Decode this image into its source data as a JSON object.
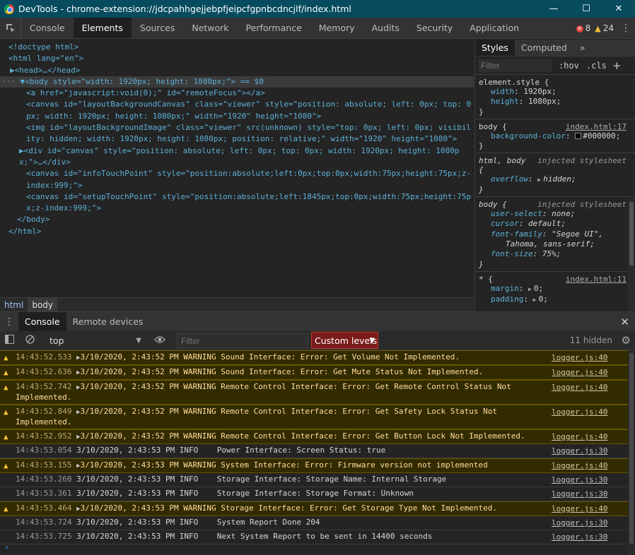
{
  "window": {
    "title": "DevTools - chrome-extension://jdcpahhgejjebpfjeipcfgpnbcdncjlf/index.html",
    "minimize": "—",
    "maximize": "☐",
    "close": "✕"
  },
  "toolbar": {
    "tabs": [
      "Console",
      "Elements",
      "Sources",
      "Network",
      "Performance",
      "Memory",
      "Audits",
      "Security",
      "Application"
    ],
    "active_tab": "Elements",
    "error_count": "8",
    "warning_count": "24"
  },
  "elements": {
    "lines": [
      {
        "text": "<!doctype html>"
      },
      {
        "text": "<html lang=\"en\">"
      },
      {
        "text": "▶<head>…</head>"
      },
      {
        "text": "▼<body style=\"width: 1920px; height: 1080px;\"> == $0"
      },
      {
        "text": "<a href=\"javascript:void(0);\" id=\"remoteFocus\"></a>"
      },
      {
        "text": "<canvas id=\"layoutBackgroundCanvas\" class=\"viewer\" style=\"position: absolute; left: 0px; top: 0px; width: 1920px; height: 1080px;\" width=\"1920\" height=\"1080\">"
      },
      {
        "text": "<img id=\"layoutBackgroundImage\" class=\"viewer\" src(unknown) style=\"top: 0px; left: 0px; visibility: hidden; width: 1920px; height: 1080px; position: relative;\" width=\"1920\" height=\"1080\">"
      },
      {
        "text": "▶<div id=\"canvas\" style=\"position: absolute; left: 0px; top: 0px; width: 1920px; height: 1080px;\">…</div>"
      },
      {
        "text": "<canvas id=\"infoTouchPoint\" style=\"position:absolute;left:0px;top:0px;width:75px;height:75px;z-index:999;\">"
      },
      {
        "text": "<canvas id=\"setupTouchPoint\" style=\"position:absolute;left:1845px;top:0px;width:75px;height:75px;z-index:999;\">"
      },
      {
        "text": "</body>"
      },
      {
        "text": "</html>"
      }
    ],
    "breadcrumbs": [
      "html",
      "body"
    ]
  },
  "styles": {
    "tabs": [
      "Styles",
      "Computed"
    ],
    "more": "»",
    "filter_placeholder": "Filter",
    "hov": ":hov",
    "cls": ".cls",
    "add": "+",
    "rules": {
      "element_style": {
        "selector": "element.style {",
        "width_name": "width",
        "width_val": "1920px;",
        "height_name": "height",
        "height_val": "1080px;",
        "close": "}"
      },
      "body_bg": {
        "selector": "body {",
        "source": "index.html:17",
        "name": "background-color",
        "value": "#000000;",
        "close": "}"
      },
      "html_body": {
        "selector": "html, body",
        "source": "injected stylesheet",
        "open": "{",
        "name": "overflow",
        "value": "hidden;",
        "close": "}"
      },
      "body_injected": {
        "selector": "body {",
        "source": "injected stylesheet",
        "p1_name": "user-select",
        "p1_val": "none;",
        "p2_name": "cursor",
        "p2_val": "default;",
        "p3_name": "font-family",
        "p3_val": "\"Segoe UI\",",
        "p3_val2": "Tahoma, sans-serif;",
        "p4_name": "font-size",
        "p4_val": "75%;",
        "close": "}"
      },
      "universal": {
        "selector": "* {",
        "source": "index.html:11",
        "p1_name": "margin",
        "p1_val": "0;",
        "p2_name": "padding",
        "p2_val": "0;"
      }
    }
  },
  "drawer": {
    "tabs": [
      "Console",
      "Remote devices"
    ],
    "active_tab": "Console",
    "close": "✕"
  },
  "console": {
    "context": "top",
    "filter_placeholder": "Filter",
    "levels": "Custom levels",
    "hidden": "11 hidden",
    "messages": [
      {
        "level": "warn",
        "ts": "14:43:52.533",
        "text": "3/10/2020, 2:43:52 PM WARNING Sound Interface: Error: Get Volume Not Implemented.",
        "src": "logger.js:40"
      },
      {
        "level": "warn",
        "ts": "14:43:52.636",
        "text": "3/10/2020, 2:43:52 PM WARNING Sound Interface: Error: Get Mute Status Not Implemented.",
        "src": "logger.js:40"
      },
      {
        "level": "warn",
        "ts": "14:43:52.742",
        "text": "3/10/2020, 2:43:52 PM WARNING Remote Control Interface: Error: Get Remote Control Status Not\nImplemented.",
        "src": "logger.js:40"
      },
      {
        "level": "warn",
        "ts": "14:43:52.849",
        "text": "3/10/2020, 2:43:52 PM WARNING Remote Control Interface: Error: Get Safety Lock Status Not\nImplemented.",
        "src": "logger.js:40"
      },
      {
        "level": "warn",
        "ts": "14:43:52.952",
        "text": "3/10/2020, 2:43:52 PM WARNING Remote Control Interface: Error: Get Button Lock Not Implemented.",
        "src": "logger.js:40"
      },
      {
        "level": "info",
        "ts": "14:43:53.054",
        "text": "3/10/2020, 2:43:53 PM INFO    Power Interface: Screen Status: true",
        "src": "logger.js:30"
      },
      {
        "level": "warn",
        "ts": "14:43:53.155",
        "text": "3/10/2020, 2:43:53 PM WARNING System Interface: Error: Firmware version not implemented",
        "src": "logger.js:40"
      },
      {
        "level": "info",
        "ts": "14:43:53.260",
        "text": "3/10/2020, 2:43:53 PM INFO    Storage Interface: Storage Name: Internal Storage",
        "src": "logger.js:30"
      },
      {
        "level": "info",
        "ts": "14:43:53.361",
        "text": "3/10/2020, 2:43:53 PM INFO    Storage Interface: Storage Format: Unknown",
        "src": "logger.js:30"
      },
      {
        "level": "warn",
        "ts": "14:43:53.464",
        "text": "3/10/2020, 2:43:53 PM WARNING Storage Interface: Error: Get Storage Type Not Implemented.",
        "src": "logger.js:40"
      },
      {
        "level": "info",
        "ts": "14:43:53.724",
        "text": "3/10/2020, 2:43:53 PM INFO    System Report Done 204",
        "src": "logger.js:30"
      },
      {
        "level": "info",
        "ts": "14:43:53.725",
        "text": "3/10/2020, 2:43:53 PM INFO    Next System Report to be sent in 14400 seconds",
        "src": "logger.js:30"
      }
    ],
    "prompt": "›"
  }
}
